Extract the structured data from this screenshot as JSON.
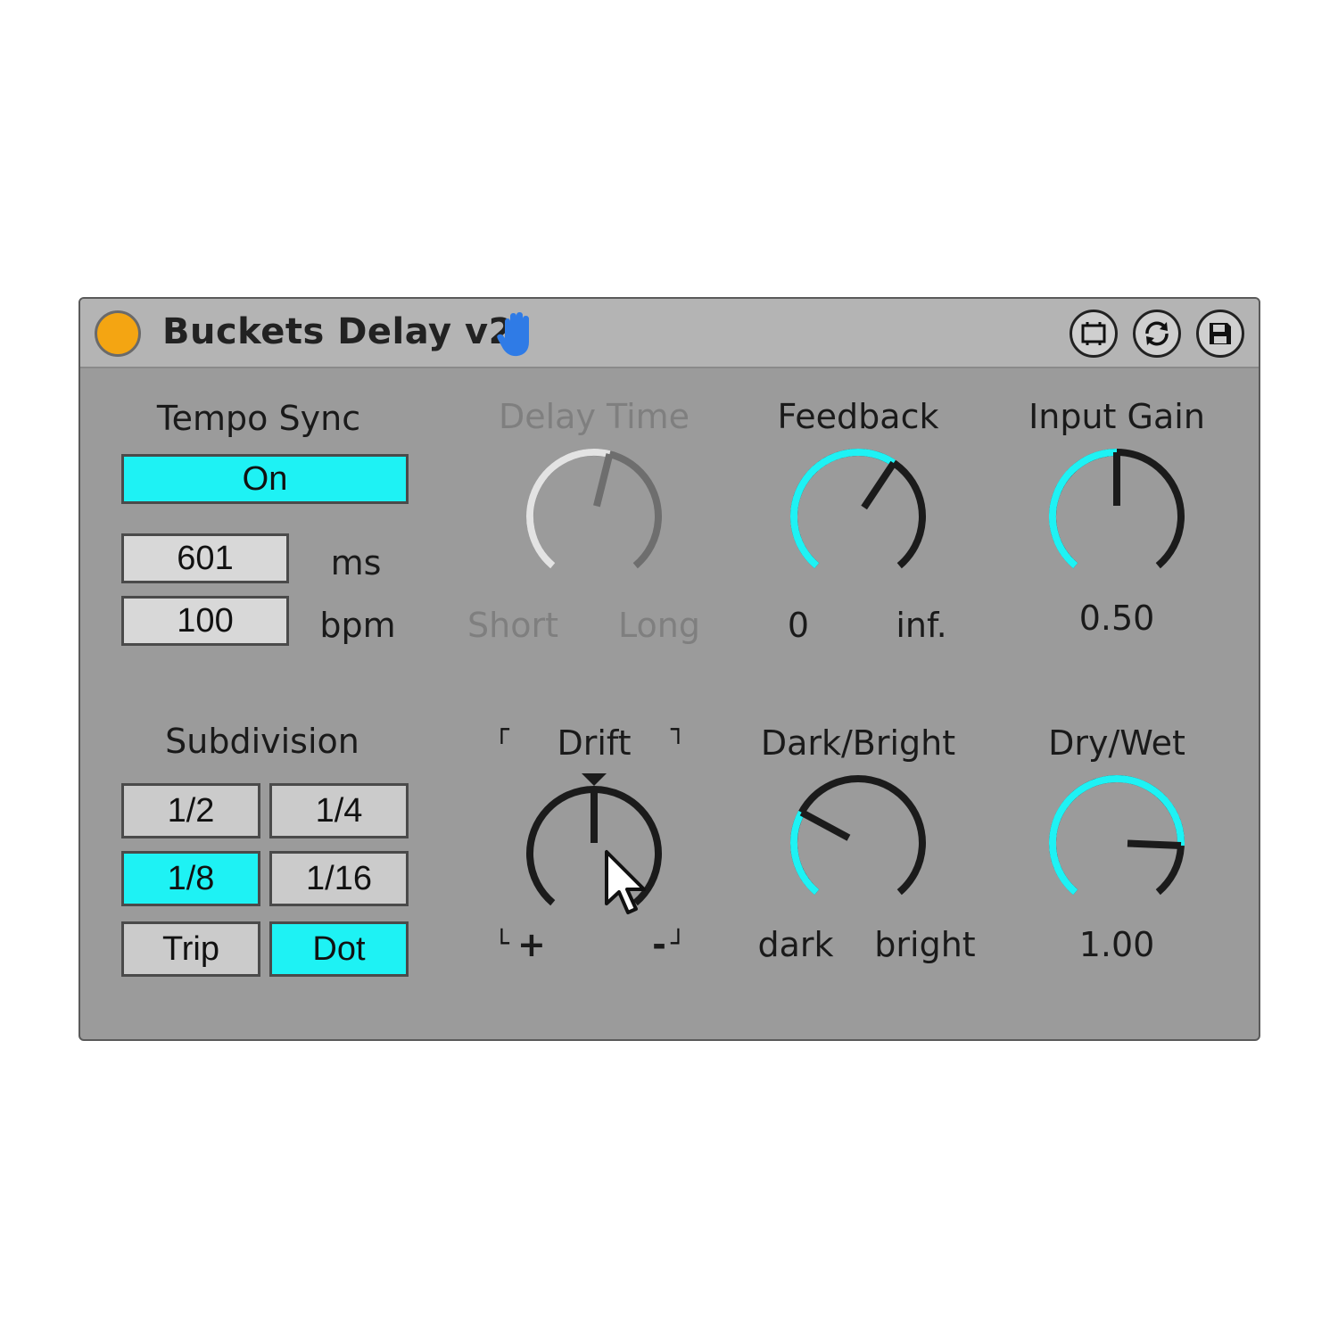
{
  "device": {
    "title": "Buckets Delay v2",
    "accent_color": "#1ef2f4",
    "power_color": "#f4a512",
    "header_icons": [
      "hand-icon",
      "fold-icon",
      "refresh-icon",
      "save-icon"
    ]
  },
  "tempo_sync": {
    "label": "Tempo Sync",
    "toggle_label": "On",
    "ms_value": "601",
    "ms_unit": "ms",
    "bpm_value": "100",
    "bpm_unit": "bpm"
  },
  "delay_time": {
    "label": "Delay Time",
    "min_label": "Short",
    "max_label": "Long",
    "value": 0.55,
    "enabled": false
  },
  "feedback": {
    "label": "Feedback",
    "min_label": "0",
    "max_label": "inf.",
    "value": 0.62
  },
  "input_gain": {
    "label": "Input Gain",
    "value_text": "0.50",
    "value": 0.5
  },
  "subdivision": {
    "label": "Subdivision",
    "buttons": [
      {
        "label": "1/2",
        "active": false
      },
      {
        "label": "1/4",
        "active": false
      },
      {
        "label": "1/8",
        "active": true
      },
      {
        "label": "1/16",
        "active": false
      },
      {
        "label": "Trip",
        "active": false
      },
      {
        "label": "Dot",
        "active": true
      }
    ]
  },
  "drift": {
    "label": "Drift",
    "min_label": "+",
    "max_label": "-",
    "value": 0.5
  },
  "dark_bright": {
    "label": "Dark/Bright",
    "min_label": "dark",
    "max_label": "bright",
    "value": 0.28
  },
  "dry_wet": {
    "label": "Dry/Wet",
    "value_text": "1.00",
    "value": 0.83
  }
}
